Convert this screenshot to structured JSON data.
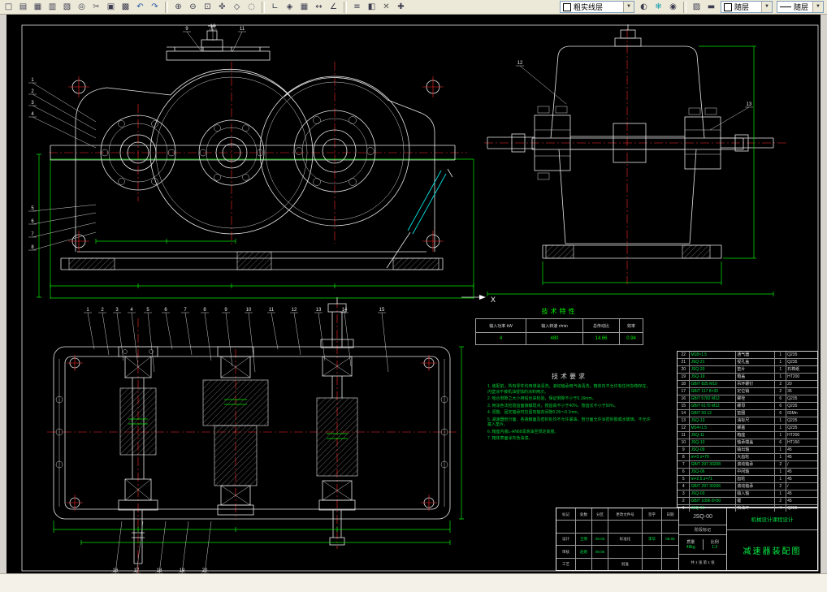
{
  "toolbar": {
    "groups": [
      [
        {
          "name": "new",
          "glyph": "□"
        },
        {
          "name": "open",
          "glyph": "▤"
        },
        {
          "name": "save",
          "glyph": "▦"
        },
        {
          "name": "print",
          "glyph": "▥"
        },
        {
          "name": "print-preview",
          "glyph": "▧"
        },
        {
          "name": "find",
          "glyph": "◎"
        },
        {
          "name": "cut",
          "glyph": "✂"
        },
        {
          "name": "copy",
          "glyph": "▣"
        },
        {
          "name": "paste",
          "glyph": "▩"
        },
        {
          "name": "undo",
          "glyph": "↶"
        },
        {
          "name": "redo",
          "glyph": "↷"
        }
      ],
      [
        {
          "name": "zoom-in",
          "glyph": "⊕"
        },
        {
          "name": "zoom-out",
          "glyph": "⊖"
        },
        {
          "name": "zoom-window",
          "glyph": "⊡"
        },
        {
          "name": "pan",
          "glyph": "✜"
        },
        {
          "name": "zoom-extents",
          "glyph": "◇"
        },
        {
          "name": "regen",
          "glyph": "◌"
        }
      ],
      [
        {
          "name": "ortho",
          "glyph": "∟"
        },
        {
          "name": "osnap",
          "glyph": "◈"
        },
        {
          "name": "grid",
          "glyph": "▦"
        },
        {
          "name": "dim-linear",
          "glyph": "↔"
        },
        {
          "name": "dim-angular",
          "glyph": "∠"
        }
      ],
      [
        {
          "name": "properties",
          "glyph": "≡"
        },
        {
          "name": "match-props",
          "glyph": "◧"
        },
        {
          "name": "erase",
          "glyph": "✕"
        },
        {
          "name": "move",
          "glyph": "✚"
        }
      ],
      [
        {
          "name": "layer-control",
          "glyph": "◐"
        },
        {
          "name": "freeze",
          "glyph": "❄"
        },
        {
          "name": "lock",
          "glyph": "◉"
        }
      ],
      [
        {
          "name": "color-control",
          "glyph": "▨"
        },
        {
          "name": "linetype-load",
          "glyph": "▬"
        }
      ]
    ],
    "layer_combo": "粗实线层",
    "color_combo": "随层",
    "linetype_combo": "随层"
  },
  "drawing": {
    "section_label": "X",
    "tech_char": {
      "title": "技术特性",
      "headers": [
        "输入功率 kW",
        "输入转速 r/min",
        "总传动比",
        "效率"
      ],
      "values": [
        "4",
        "480",
        "14.66",
        "0.94"
      ]
    },
    "tech_req": {
      "title": "技术要求",
      "items": [
        "1. 装配前，所有零件均用煤油清洗，滚动轴承用汽油清洗，箱体内不允许有任何杂物存在，内壁涂不被机油侵蚀的涂料两次。",
        "2. 啮合侧隙之大小用铅丝来检验，保证侧隙不小于0.16mm。",
        "3. 用涂色法检验齿面接触斑点，按齿高不小于40%，按齿长不小于50%。",
        "4. 调整、固定轴承时应留有轴向间隙0.05～0.1mm。",
        "5. 减速器剖分面、各接触面及密封处均不允许漏油，剖分面允许涂密封胶或水玻璃，不允许塞入垫片。",
        "6. 箱座内装L-AN68润滑油至规定高度。",
        "7. 箱体表面涂灰色油漆。"
      ]
    },
    "balloons": {
      "top": [
        "1",
        "2",
        "3",
        "4",
        "5",
        "6",
        "7",
        "8",
        "9",
        "10",
        "11",
        "12",
        "13",
        "14",
        "15"
      ],
      "bottom": [
        "16",
        "17",
        "18",
        "19",
        "20"
      ],
      "front_left": [
        "1",
        "2",
        "3",
        "4",
        "5",
        "6",
        "7",
        "8"
      ],
      "front_top": [
        "9",
        "10",
        "11"
      ],
      "side": [
        "12",
        "13"
      ]
    }
  },
  "parts": {
    "rows": [
      {
        "no": "22",
        "code": "M18×1.5",
        "name": "通气器",
        "qty": "1",
        "mat": "Q235"
      },
      {
        "no": "21",
        "code": "JSQ-21",
        "name": "视孔盖",
        "qty": "1",
        "mat": "Q235"
      },
      {
        "no": "20",
        "code": "JSQ-20",
        "name": "垫片",
        "qty": "1",
        "mat": "石棉纸"
      },
      {
        "no": "19",
        "code": "JSQ-19",
        "name": "箱盖",
        "qty": "1",
        "mat": "HT200"
      },
      {
        "no": "18",
        "code": "GB/T 825 M10",
        "name": "吊环螺钉",
        "qty": "2",
        "mat": "20"
      },
      {
        "no": "17",
        "code": "GB/T 117 8×30",
        "name": "定位销",
        "qty": "2",
        "mat": "35"
      },
      {
        "no": "16",
        "code": "GB/T 5782 M12",
        "name": "螺栓",
        "qty": "6",
        "mat": "Q235"
      },
      {
        "no": "15",
        "code": "GB/T 6170 M12",
        "name": "螺母",
        "qty": "6",
        "mat": "Q235"
      },
      {
        "no": "14",
        "code": "GB/T 93 12",
        "name": "垫圈",
        "qty": "6",
        "mat": "65Mn"
      },
      {
        "no": "13",
        "code": "JSQ-13",
        "name": "油标尺",
        "qty": "1",
        "mat": "Q235"
      },
      {
        "no": "12",
        "code": "M14×1.5",
        "name": "螺塞",
        "qty": "1",
        "mat": "Q235"
      },
      {
        "no": "11",
        "code": "JSQ-11",
        "name": "箱座",
        "qty": "1",
        "mat": "HT200"
      },
      {
        "no": "10",
        "code": "JSQ-10",
        "name": "轴承端盖",
        "qty": "6",
        "mat": "HT150"
      },
      {
        "no": "9",
        "code": "JSQ-09",
        "name": "输出轴",
        "qty": "1",
        "mat": "45"
      },
      {
        "no": "8",
        "code": "m=3 z=79",
        "name": "大齿轮",
        "qty": "1",
        "mat": "45"
      },
      {
        "no": "7",
        "code": "GB/T 297 30208",
        "name": "滚动轴承",
        "qty": "2",
        "mat": "/"
      },
      {
        "no": "6",
        "code": "JSQ-06",
        "name": "中间轴",
        "qty": "1",
        "mat": "45"
      },
      {
        "no": "5",
        "code": "m=2.5 z=71",
        "name": "齿轮",
        "qty": "1",
        "mat": "45"
      },
      {
        "no": "4",
        "code": "GB/T 297 30206",
        "name": "滚动轴承",
        "qty": "2",
        "mat": "/"
      },
      {
        "no": "3",
        "code": "JSQ-03",
        "name": "输入轴",
        "qty": "1",
        "mat": "45"
      },
      {
        "no": "2",
        "code": "GB/T 1096 8×50",
        "name": "键",
        "qty": "2",
        "mat": "45"
      },
      {
        "no": "1",
        "code": "JSQ-01",
        "name": "挡油环",
        "qty": "4",
        "mat": "Q235"
      }
    ]
  },
  "title_block": {
    "sign_header": [
      "标记",
      "处数",
      "分区",
      "更改文件号",
      "签字",
      "日期"
    ],
    "sign_rows": [
      [
        "设计",
        "王明",
        "08.06",
        "标准化",
        "李华",
        "08.06"
      ],
      [
        "审核",
        "赵刚",
        "08.06",
        "",
        "",
        ""
      ],
      [
        "工艺",
        "",
        "",
        "批准",
        "",
        ""
      ]
    ],
    "code": "JSQ-00",
    "stage_label": "阶段标记",
    "mass_label": "质量",
    "mass": "48kg",
    "scale_label": "比例",
    "scale": "1:2",
    "sheets": "共 1 张  第 1 张",
    "unit": "机械设计课程设计",
    "name": "减速器装配图"
  }
}
